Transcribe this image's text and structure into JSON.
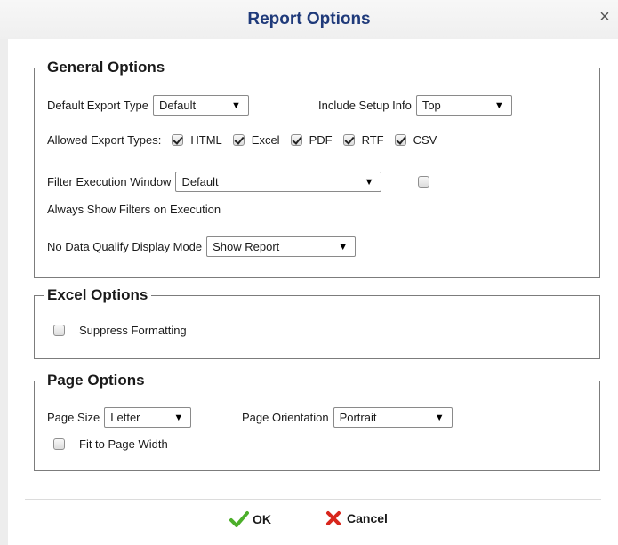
{
  "dialog": {
    "title": "Report Options",
    "close_glyph": "×"
  },
  "general": {
    "legend": "General Options",
    "default_export_type": {
      "label": "Default Export Type",
      "value": "Default"
    },
    "include_setup_info": {
      "label": "Include Setup Info",
      "value": "Top"
    },
    "allowed_export_types": {
      "label": "Allowed Export Types:",
      "options": [
        {
          "label": "HTML",
          "checked": true
        },
        {
          "label": "Excel",
          "checked": true
        },
        {
          "label": "PDF",
          "checked": true
        },
        {
          "label": "RTF",
          "checked": true
        },
        {
          "label": "CSV",
          "checked": true
        }
      ]
    },
    "filter_execution_window": {
      "label": "Filter Execution Window",
      "value": "Default"
    },
    "always_show_filters": {
      "label": "Always Show Filters on Execution",
      "checked": false
    },
    "no_data_display_mode": {
      "label": "No Data Qualify Display Mode",
      "value": "Show Report"
    }
  },
  "excel": {
    "legend": "Excel Options",
    "suppress_formatting": {
      "label": "Suppress Formatting",
      "checked": false
    }
  },
  "page": {
    "legend": "Page Options",
    "page_size": {
      "label": "Page Size",
      "value": "Letter"
    },
    "page_orientation": {
      "label": "Page Orientation",
      "value": "Portrait"
    },
    "fit_to_page_width": {
      "label": "Fit to Page Width",
      "checked": false
    }
  },
  "footer": {
    "ok_label": "OK",
    "cancel_label": "Cancel"
  },
  "colors": {
    "title": "#1f3a7a",
    "ok_icon": "#4caf2a",
    "cancel_icon": "#d8261c"
  },
  "icons": [
    "close-icon",
    "dropdown-arrow-icon",
    "checkmark-icon",
    "x-icon"
  ]
}
